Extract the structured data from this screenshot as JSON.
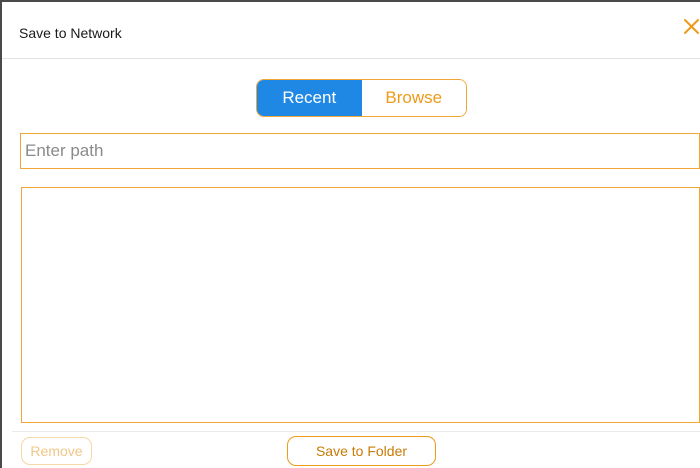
{
  "dialog": {
    "title": "Save to Network",
    "close_icon": "close-icon",
    "accent_color": "#f0a637",
    "active_tab_color": "#1f88e5"
  },
  "tabs": [
    {
      "label": "Recent",
      "active": true
    },
    {
      "label": "Browse",
      "active": false
    }
  ],
  "path_input": {
    "placeholder": "Enter path",
    "value": ""
  },
  "path_list": {
    "items": []
  },
  "footer": {
    "remove_label": "Remove",
    "remove_disabled": true,
    "save_label": "Save to Folder"
  }
}
